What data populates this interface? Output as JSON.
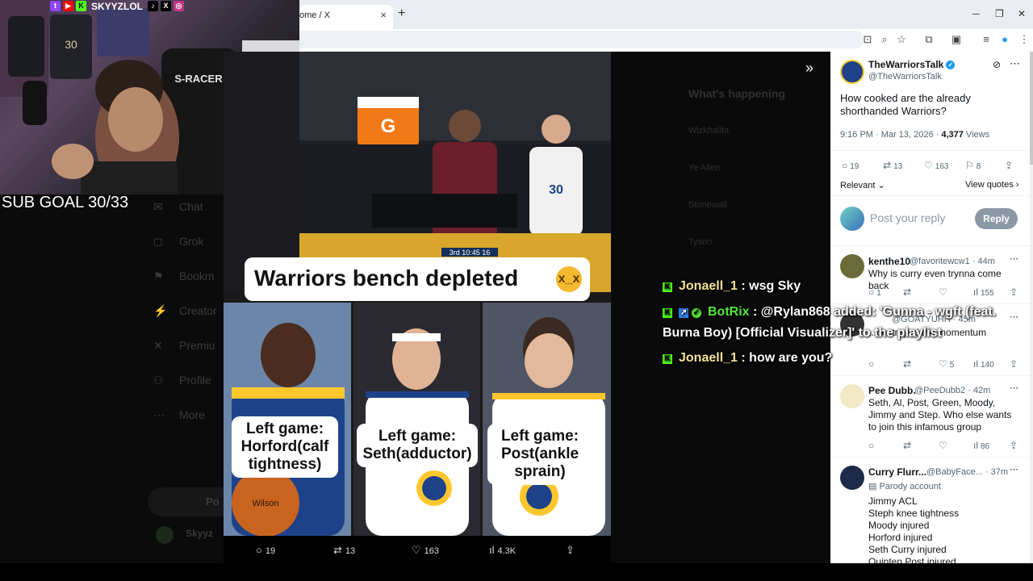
{
  "browser": {
    "tab_title": "ome / X",
    "tab_close": "×",
    "new_tab": "+",
    "minimize": "─",
    "restore": "❐",
    "close": "✕"
  },
  "stream": {
    "handle": "SKYYZLOL",
    "sub_goal": "SUB GOAL 30/33",
    "shirt_number": "30",
    "chair_brand": "S-RACER"
  },
  "x_left": {
    "nav": [
      {
        "icon": "✉",
        "label": "Chat"
      },
      {
        "icon": "◻",
        "label": "Grok"
      },
      {
        "icon": "⚑",
        "label": "Bookm"
      },
      {
        "icon": "⚡",
        "label": "Creator"
      },
      {
        "icon": "✕",
        "label": "Premiu"
      },
      {
        "icon": "⚇",
        "label": "Profile"
      },
      {
        "icon": "⋯",
        "label": "More"
      }
    ],
    "post_label": "Po",
    "account_label": "Skyyz"
  },
  "x_mid": {
    "heading": "What's happening",
    "trends": [
      "Wizkhalifa",
      "Ye Allen",
      "Stonewall",
      "Tyson"
    ]
  },
  "media": {
    "banner": "Warriors bench depleted",
    "emoji": "x_x",
    "jersey_number": "30",
    "scoreboard": "3rd 10:45 16",
    "captions": [
      "Left game: Horford(calf tightness)",
      "Left game: Seth(adductor)",
      "Left game: Post(ankle sprain)"
    ],
    "ball_text": "Wilson"
  },
  "media_bar": {
    "replies": "19",
    "reposts": "13",
    "likes": "163",
    "views": "4.3K"
  },
  "chat": [
    {
      "user": "Jonaell_1",
      "color": "#f6e29a",
      "text": ": wsg Sky"
    },
    {
      "user": "BotRix",
      "color": "#54e83b",
      "text": ": @Rylan868 added: 'Gunna - wgft (feat.",
      "text2": "Burna Boy) [Official Visualizer]' to the playlist"
    },
    {
      "user": "Jonaell_1",
      "color": "#f6e29a",
      "text": ": how are you?"
    }
  ],
  "post": {
    "author_name": "TheWarriorsTalk",
    "author_handle": "@TheWarriorsTalk",
    "text": "How cooked are the already shorthanded Warriors?",
    "time": "9:16 PM · Mar 13, 2026 · ",
    "views_count": "4,377",
    "views_label": " Views",
    "replies": "19",
    "reposts": "13",
    "likes": "163",
    "bookmarks": "8",
    "sort": "Relevant",
    "view_quotes": "View quotes",
    "reply_placeholder": "Post your reply",
    "reply_button": "Reply",
    "expand_label": "»"
  },
  "replies": [
    {
      "name": "kenthe10",
      "handle": "@favoritewcw1 · 44m",
      "text": "Why is curry even trynna come back",
      "replies": "1",
      "views": "155"
    },
    {
      "name": "",
      "handle": "@GOATYUHH · 45m",
      "text": "...destroyed the momentum",
      "replies": "",
      "likes": "5",
      "views": "140"
    },
    {
      "name": "Pee Dubb.",
      "handle": "@PeeDubb2 · 42m",
      "text": "Seth, Al, Post, Green, Moody, Jimmy and Step. Who else wants to join this infamous group",
      "views": "86"
    },
    {
      "name": "Curry Flurr...",
      "handle": "@BabyFace... · 37m",
      "parody": "Parody account",
      "lines": [
        "Jimmy ACL",
        "Steph knee tightness",
        "Moody injured",
        "Horford injured",
        "Seth Curry injured",
        "Quinten Post injured"
      ]
    }
  ],
  "colors": {
    "kick_green": "#53fc18",
    "x_blue": "#1d9bf0",
    "warriors_blue": "#1d428a",
    "warriors_gold": "#ffc72c"
  }
}
